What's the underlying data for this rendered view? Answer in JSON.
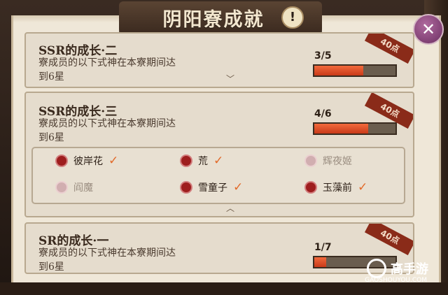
{
  "header": {
    "title": "阴阳寮成就",
    "badge": "!"
  },
  "close_icon": "close-icon",
  "cards": [
    {
      "name": "SSR的成长·二",
      "desc_line1": "寮成员的以下式神在本寮期间达",
      "desc_line2": "到6星",
      "count": "3/5",
      "progress": 0.6,
      "points": "40点"
    },
    {
      "name": "SSR的成长·三",
      "desc_line1": "寮成员的以下式神在本寮期间达",
      "desc_line2": "到6星",
      "count": "4/6",
      "progress": 0.667,
      "points": "40点"
    },
    {
      "name": "SR的成长·一",
      "desc_line1": "寮成员的以下式神在本寮期间达",
      "desc_line2": "到6星",
      "count": "1/7",
      "progress": 0.143,
      "points": "40点"
    }
  ],
  "shikigami": [
    {
      "name": "彼岸花",
      "done": true
    },
    {
      "name": "荒",
      "done": true
    },
    {
      "name": "辉夜姬",
      "done": false
    },
    {
      "name": "阎魔",
      "done": false
    },
    {
      "name": "雪童子",
      "done": true
    },
    {
      "name": "玉藻前",
      "done": true
    }
  ],
  "watermark": {
    "title": "高手游",
    "sub": "GAOSHOUYOU.COM"
  }
}
